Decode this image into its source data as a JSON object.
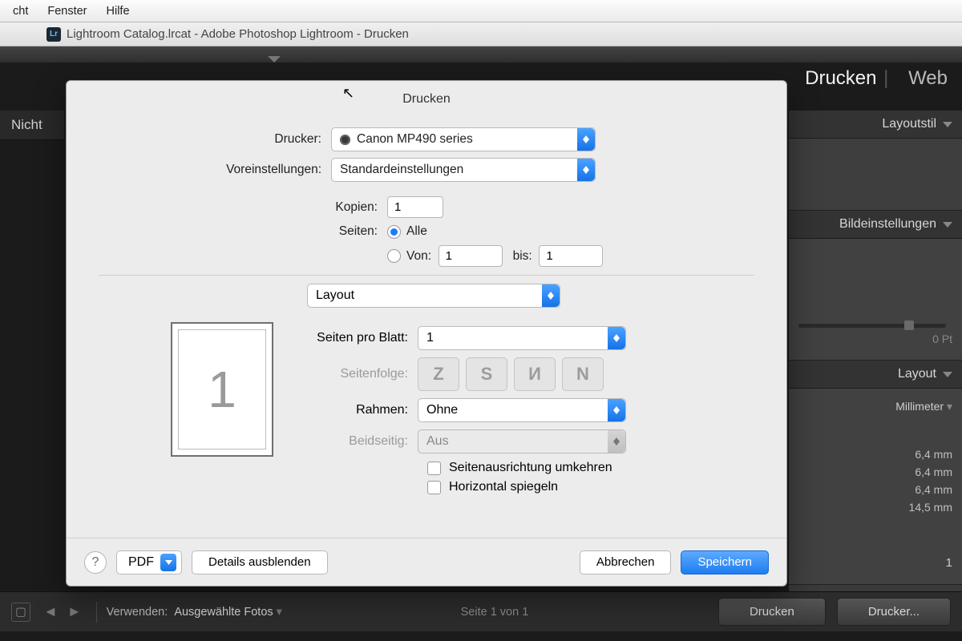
{
  "menubar": {
    "item1": "cht",
    "item2": "Fenster",
    "item3": "Hilfe"
  },
  "window_title": "Lightroom Catalog.lrcat - Adobe Photoshop Lightroom - Drucken",
  "modules": {
    "print": "Drucken",
    "web": "Web"
  },
  "left_panel": {
    "header": "Nicht"
  },
  "right_panels": {
    "layoutstil": "Layoutstil",
    "bildeinstellungen": "Bildeinstellungen",
    "slider_val": "0 Pt",
    "layout": "Layout",
    "unit": "Millimeter",
    "margins": {
      "m1": "6,4 mm",
      "m2": "6,4 mm",
      "m3": "6,4 mm",
      "m4": "14,5 mm"
    },
    "pagenum": "1"
  },
  "bottombar": {
    "use_label": "Verwenden:",
    "use_value": "Ausgewählte Fotos",
    "page_status": "Seite 1 von 1",
    "print_btn": "Drucken",
    "printer_btn": "Drucker..."
  },
  "dialog": {
    "title": "Drucken",
    "printer_label": "Drucker:",
    "printer_value": "Canon MP490 series",
    "presets_label": "Voreinstellungen:",
    "presets_value": "Standardeinstellungen",
    "copies_label": "Kopien:",
    "copies_value": "1",
    "pages_label": "Seiten:",
    "pages_all": "Alle",
    "pages_from": "Von:",
    "pages_from_val": "1",
    "pages_to": "bis:",
    "pages_to_val": "1",
    "section_select": "Layout",
    "preview_num": "1",
    "pps_label": "Seiten pro Blatt:",
    "pps_value": "1",
    "order_label": "Seitenfolge:",
    "border_label": "Rahmen:",
    "border_value": "Ohne",
    "duplex_label": "Beidseitig:",
    "duplex_value": "Aus",
    "reverse_cb": "Seitenausrichtung umkehren",
    "mirror_cb": "Horizontal spiegeln",
    "footer": {
      "pdf": "PDF",
      "details": "Details ausblenden",
      "cancel": "Abbrechen",
      "save": "Speichern"
    }
  }
}
